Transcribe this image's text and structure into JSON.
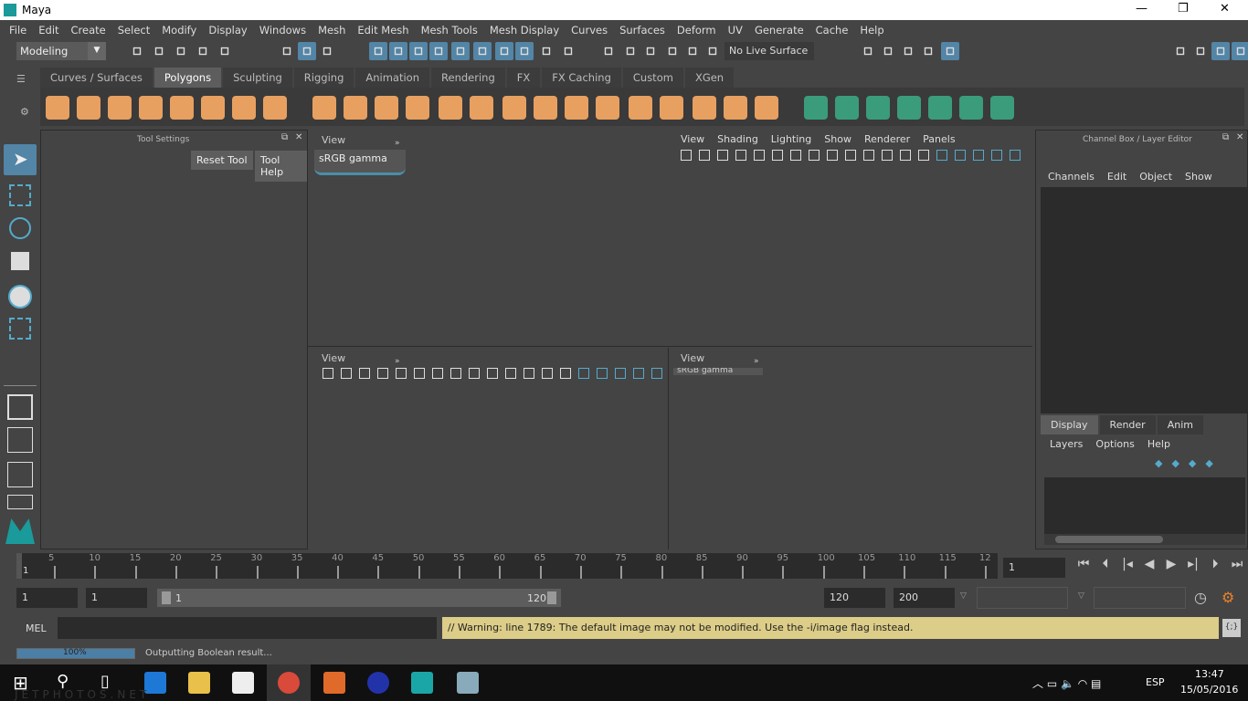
{
  "window": {
    "title": "Maya",
    "controls": [
      "—",
      "❐",
      "✕"
    ]
  },
  "menu": [
    "File",
    "Edit",
    "Create",
    "Select",
    "Modify",
    "Display",
    "Windows",
    "Mesh",
    "Edit Mesh",
    "Mesh Tools",
    "Mesh Display",
    "Curves",
    "Surfaces",
    "Deform",
    "UV",
    "Generate",
    "Cache",
    "Help"
  ],
  "toolbar": {
    "mode": "Modeling",
    "live_surface": "No Live Surface"
  },
  "shelf": {
    "tabs": [
      "Curves / Surfaces",
      "Polygons",
      "Sculpting",
      "Rigging",
      "Animation",
      "Rendering",
      "FX",
      "FX Caching",
      "Custom",
      "XGen"
    ],
    "active": "Polygons"
  },
  "tool_settings": {
    "title": "Tool Settings",
    "reset": "Reset Tool",
    "help": "Tool Help"
  },
  "viewport_top": {
    "view": "View",
    "colorspace": "sRGB gamma",
    "menu": [
      "View",
      "Shading",
      "Lighting",
      "Show",
      "Renderer",
      "Panels"
    ]
  },
  "viewport_bottom_left": {
    "view": "View"
  },
  "viewport_bottom_right": {
    "view": "View",
    "colorspace": "sRGB gamma"
  },
  "channel_box": {
    "title": "Channel Box / Layer Editor",
    "menu": [
      "Channels",
      "Edit",
      "Object",
      "Show"
    ]
  },
  "layer_editor": {
    "tabs": [
      "Display",
      "Render",
      "Anim"
    ],
    "active": "Display",
    "menu": [
      "Layers",
      "Options",
      "Help"
    ]
  },
  "timeline": {
    "ticks": [
      "5",
      "10",
      "15",
      "20",
      "25",
      "30",
      "35",
      "40",
      "45",
      "50",
      "55",
      "60",
      "65",
      "70",
      "75",
      "80",
      "85",
      "90",
      "95",
      "100",
      "105",
      "110",
      "115",
      "12"
    ],
    "current_label": "1",
    "current_frame": "1"
  },
  "range": {
    "start": "1",
    "playback_start": "1",
    "slider_start": "1",
    "slider_end": "120",
    "playback_end": "120",
    "end": "200"
  },
  "command": {
    "lang": "MEL",
    "warning": "// Warning: line 1789: The default image may not be modified. Use the -i/image flag instead."
  },
  "help_line": {
    "progress": "100%",
    "progress_value": 100,
    "message": "Outputting Boolean result..."
  },
  "taskbar": {
    "lang": "ESP",
    "time": "13:47",
    "date": "15/05/2016",
    "watermark": "JETPHOTOS.NET"
  }
}
